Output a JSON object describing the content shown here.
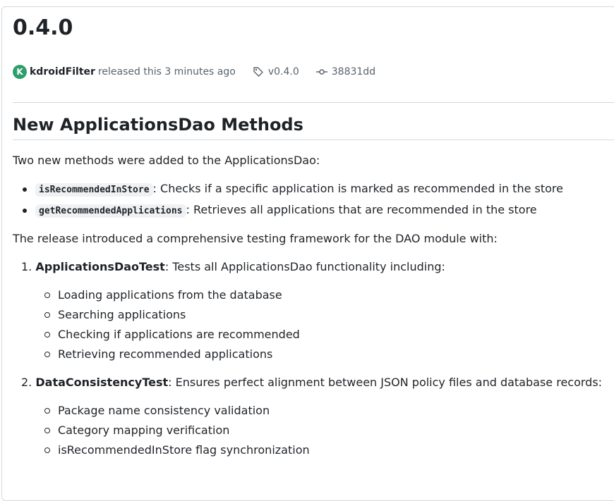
{
  "release": {
    "title": "0.4.0",
    "author": "kdroidFilter",
    "avatar_initial": "K",
    "released_text": "released this 3 minutes ago",
    "tag": "v0.4.0",
    "commit": "38831dd"
  },
  "notes": {
    "heading": "New ApplicationsDao Methods",
    "intro": "Two new methods were added to the ApplicationsDao:",
    "methods": [
      {
        "code": "isRecommendedInStore",
        "desc": ": Checks if a specific application is marked as recommended in the store"
      },
      {
        "code": "getRecommendedApplications",
        "desc": ": Retrieves all applications that are recommended in the store"
      }
    ],
    "framework_intro": "The release introduced a comprehensive testing framework for the DAO module with:",
    "tests": [
      {
        "number": "1.",
        "name": "ApplicationsDaoTest",
        "desc": ": Tests all ApplicationsDao functionality including:",
        "items": [
          "Loading applications from the database",
          "Searching applications",
          "Checking if applications are recommended",
          "Retrieving recommended applications"
        ]
      },
      {
        "number": "2.",
        "name": "DataConsistencyTest",
        "desc": ": Ensures perfect alignment between JSON policy files and database records:",
        "items": [
          "Package name consistency validation",
          "Category mapping verification",
          "isRecommendedInStore flag synchronization"
        ]
      }
    ]
  },
  "colors": {
    "text": "#1f2328",
    "muted": "#59636e",
    "border": "#d1d9e0",
    "code_bg": "#eff1f3",
    "avatar": "#2e9e6b"
  }
}
